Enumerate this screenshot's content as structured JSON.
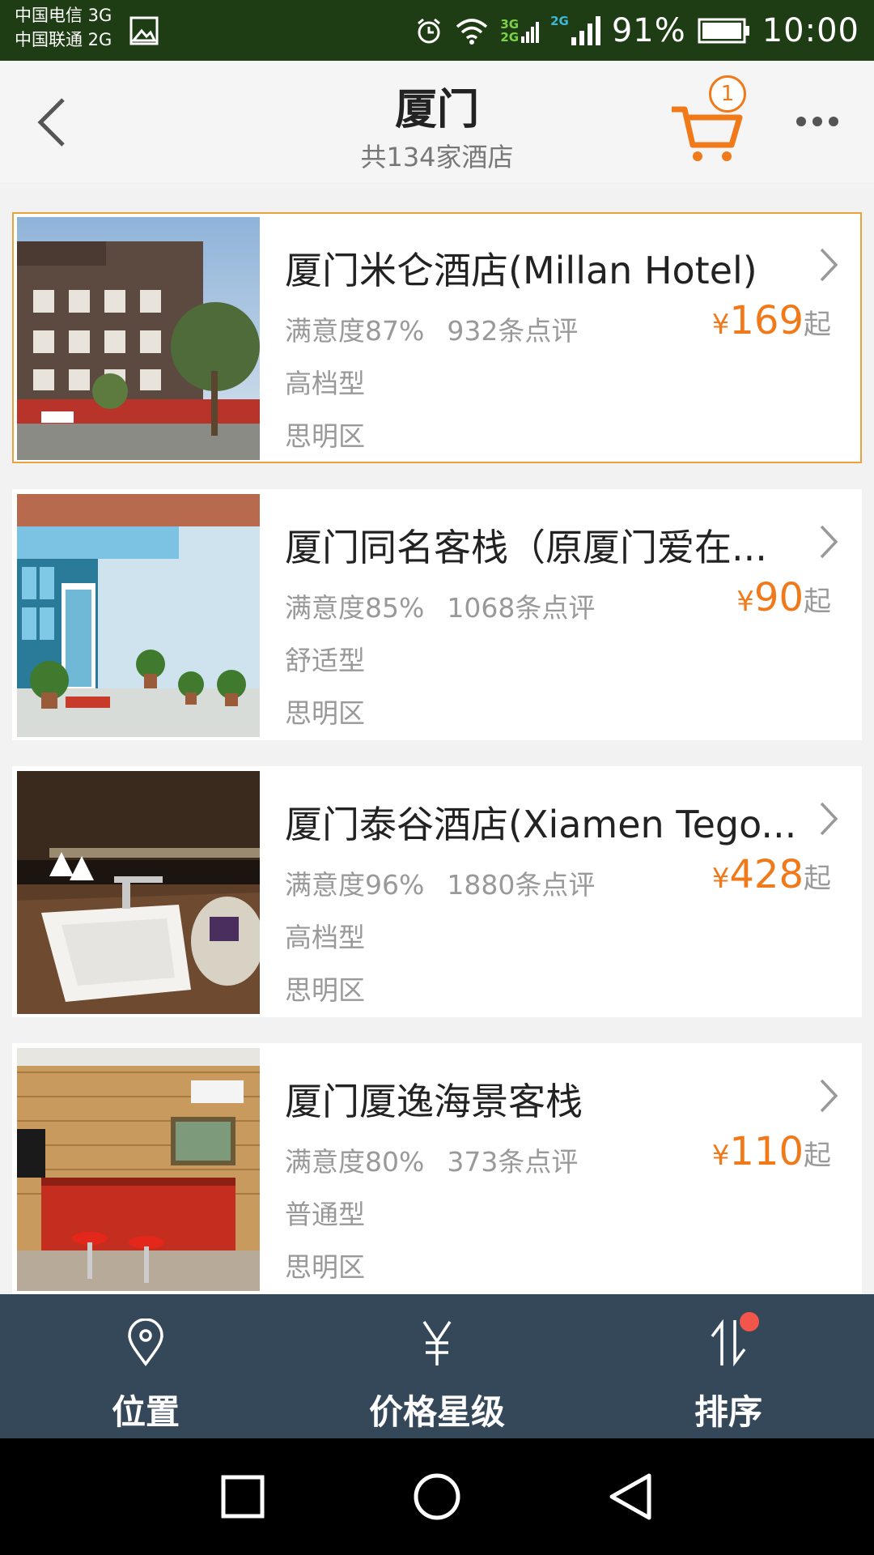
{
  "status_bar": {
    "carrier_1": "中国电信 3G",
    "carrier_2": "中国联通 2G",
    "net_3g": "3G",
    "net_2g_a": "2G",
    "net_2g_b": "2G",
    "battery": "91%",
    "time": "10:00"
  },
  "header": {
    "title": "厦门",
    "subtitle": "共134家酒店",
    "cart_count": "1"
  },
  "hotels": [
    {
      "name": "厦门米仑酒店(Millan Hotel)",
      "satisfaction": "满意度87%",
      "reviews": "932条点评",
      "currency": "¥",
      "price": "169",
      "price_suffix": "起",
      "grade": "高档型",
      "district": "思明区"
    },
    {
      "name": "厦门同名客栈（原厦门爱在...",
      "satisfaction": "满意度85%",
      "reviews": "1068条点评",
      "currency": "¥",
      "price": "90",
      "price_suffix": "起",
      "grade": "舒适型",
      "district": "思明区"
    },
    {
      "name": "厦门泰谷酒店(Xiamen Tego...",
      "satisfaction": "满意度96%",
      "reviews": "1880条点评",
      "currency": "¥",
      "price": "428",
      "price_suffix": "起",
      "grade": "高档型",
      "district": "思明区"
    },
    {
      "name": "厦门厦逸海景客栈",
      "satisfaction": "满意度80%",
      "reviews": "373条点评",
      "currency": "¥",
      "price": "110",
      "price_suffix": "起",
      "grade": "普通型",
      "district": "思明区"
    }
  ],
  "filter_bar": {
    "location": "位置",
    "price_star": "价格星级",
    "sort": "排序"
  },
  "colors": {
    "accent": "#f07a1a",
    "status_bar": "#1f3d14",
    "filter_bar": "#35485a",
    "badge_dot": "#f1554c",
    "selected_border": "#e8a33c"
  }
}
